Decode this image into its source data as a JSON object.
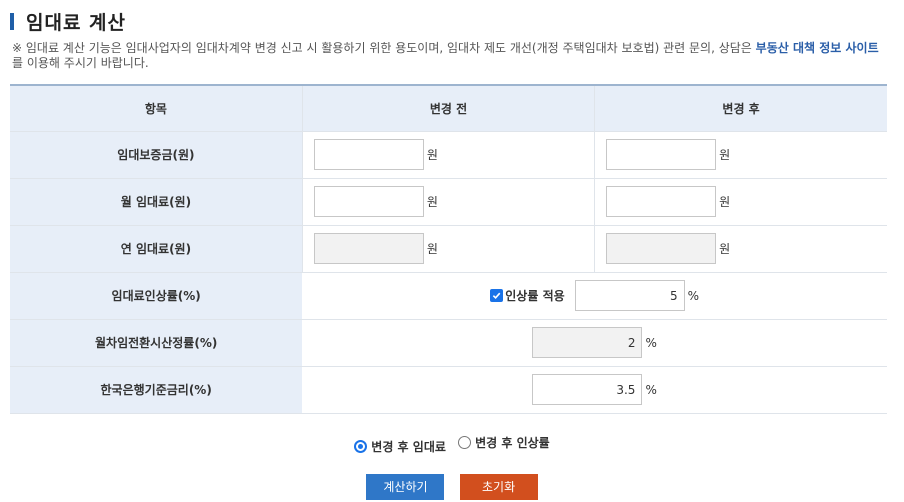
{
  "page": {
    "title": "임대료 계산",
    "notice_text": "※ 임대료 계산 기능은 임대사업자의 임대차계약 변경 신고 시 활용하기 위한 용도이며, 임대차 제도 개선(개정 주택임대차 보호법) 관련 문의, 상담은 ",
    "notice_link": "부동산 대책 정보 사이트",
    "notice_tail": " 를 이용해 주시기 바랍니다."
  },
  "table": {
    "headers": [
      "항목",
      "변경 전",
      "변경 후"
    ],
    "rows": [
      {
        "label": "임대보증금(원)",
        "before": "",
        "after": "",
        "unit": "원"
      },
      {
        "label": "월 임대료(원)",
        "before": "",
        "after": "",
        "unit": "원"
      },
      {
        "label": "연 임대료(원)",
        "before": "",
        "after": "",
        "unit": "원"
      }
    ],
    "increase_rate": {
      "label": "임대료인상률(%)",
      "checkbox_label": "인상률 적용",
      "checked": true,
      "value": "5",
      "unit": "%"
    },
    "conversion_rate": {
      "label": "월차임전환시산정률(%)",
      "value": "2",
      "unit": "%"
    },
    "base_rate": {
      "label": "한국은행기준금리(%)",
      "value": "3.5",
      "unit": "%"
    }
  },
  "options": {
    "radio_rent_label": "변경 후 임대료",
    "radio_rate_label": "변경 후 인상률",
    "selected": "rent"
  },
  "buttons": {
    "calculate": "계산하기",
    "reset": "초기화"
  },
  "colors": {
    "accent": "#1f5fa8",
    "header_bg": "#e7eef8",
    "calculate_btn": "#2f77c8",
    "reset_btn": "#d24f1e"
  }
}
